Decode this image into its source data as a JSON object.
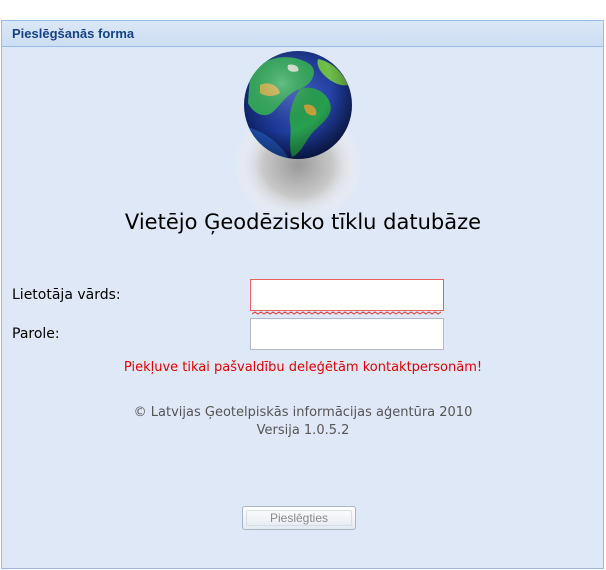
{
  "panel": {
    "title": "Pieslēgšanās forma"
  },
  "logo": {
    "icon": "globe-icon"
  },
  "app_title": "Vietējo Ģeodēzisko tīklu datubāze",
  "form": {
    "username_label": "Lietotāja vārds:",
    "username_value": "",
    "username_state": "invalid",
    "password_label": "Parole:",
    "password_value": ""
  },
  "warning": "Piekļuve tikai pašvaldību deleģētām kontaktpersonām!",
  "footer": {
    "copyright": "© Latvijas Ģeotelpiskās informācijas aģentūra 2010",
    "version": "Versija 1.0.5.2"
  },
  "login_button": {
    "label": "Pieslēgties",
    "enabled": false
  },
  "colors": {
    "panel_bg": "#dfe8f6",
    "header_title": "#15428b",
    "warning": "#e60000",
    "invalid_border": "#e8645a"
  }
}
